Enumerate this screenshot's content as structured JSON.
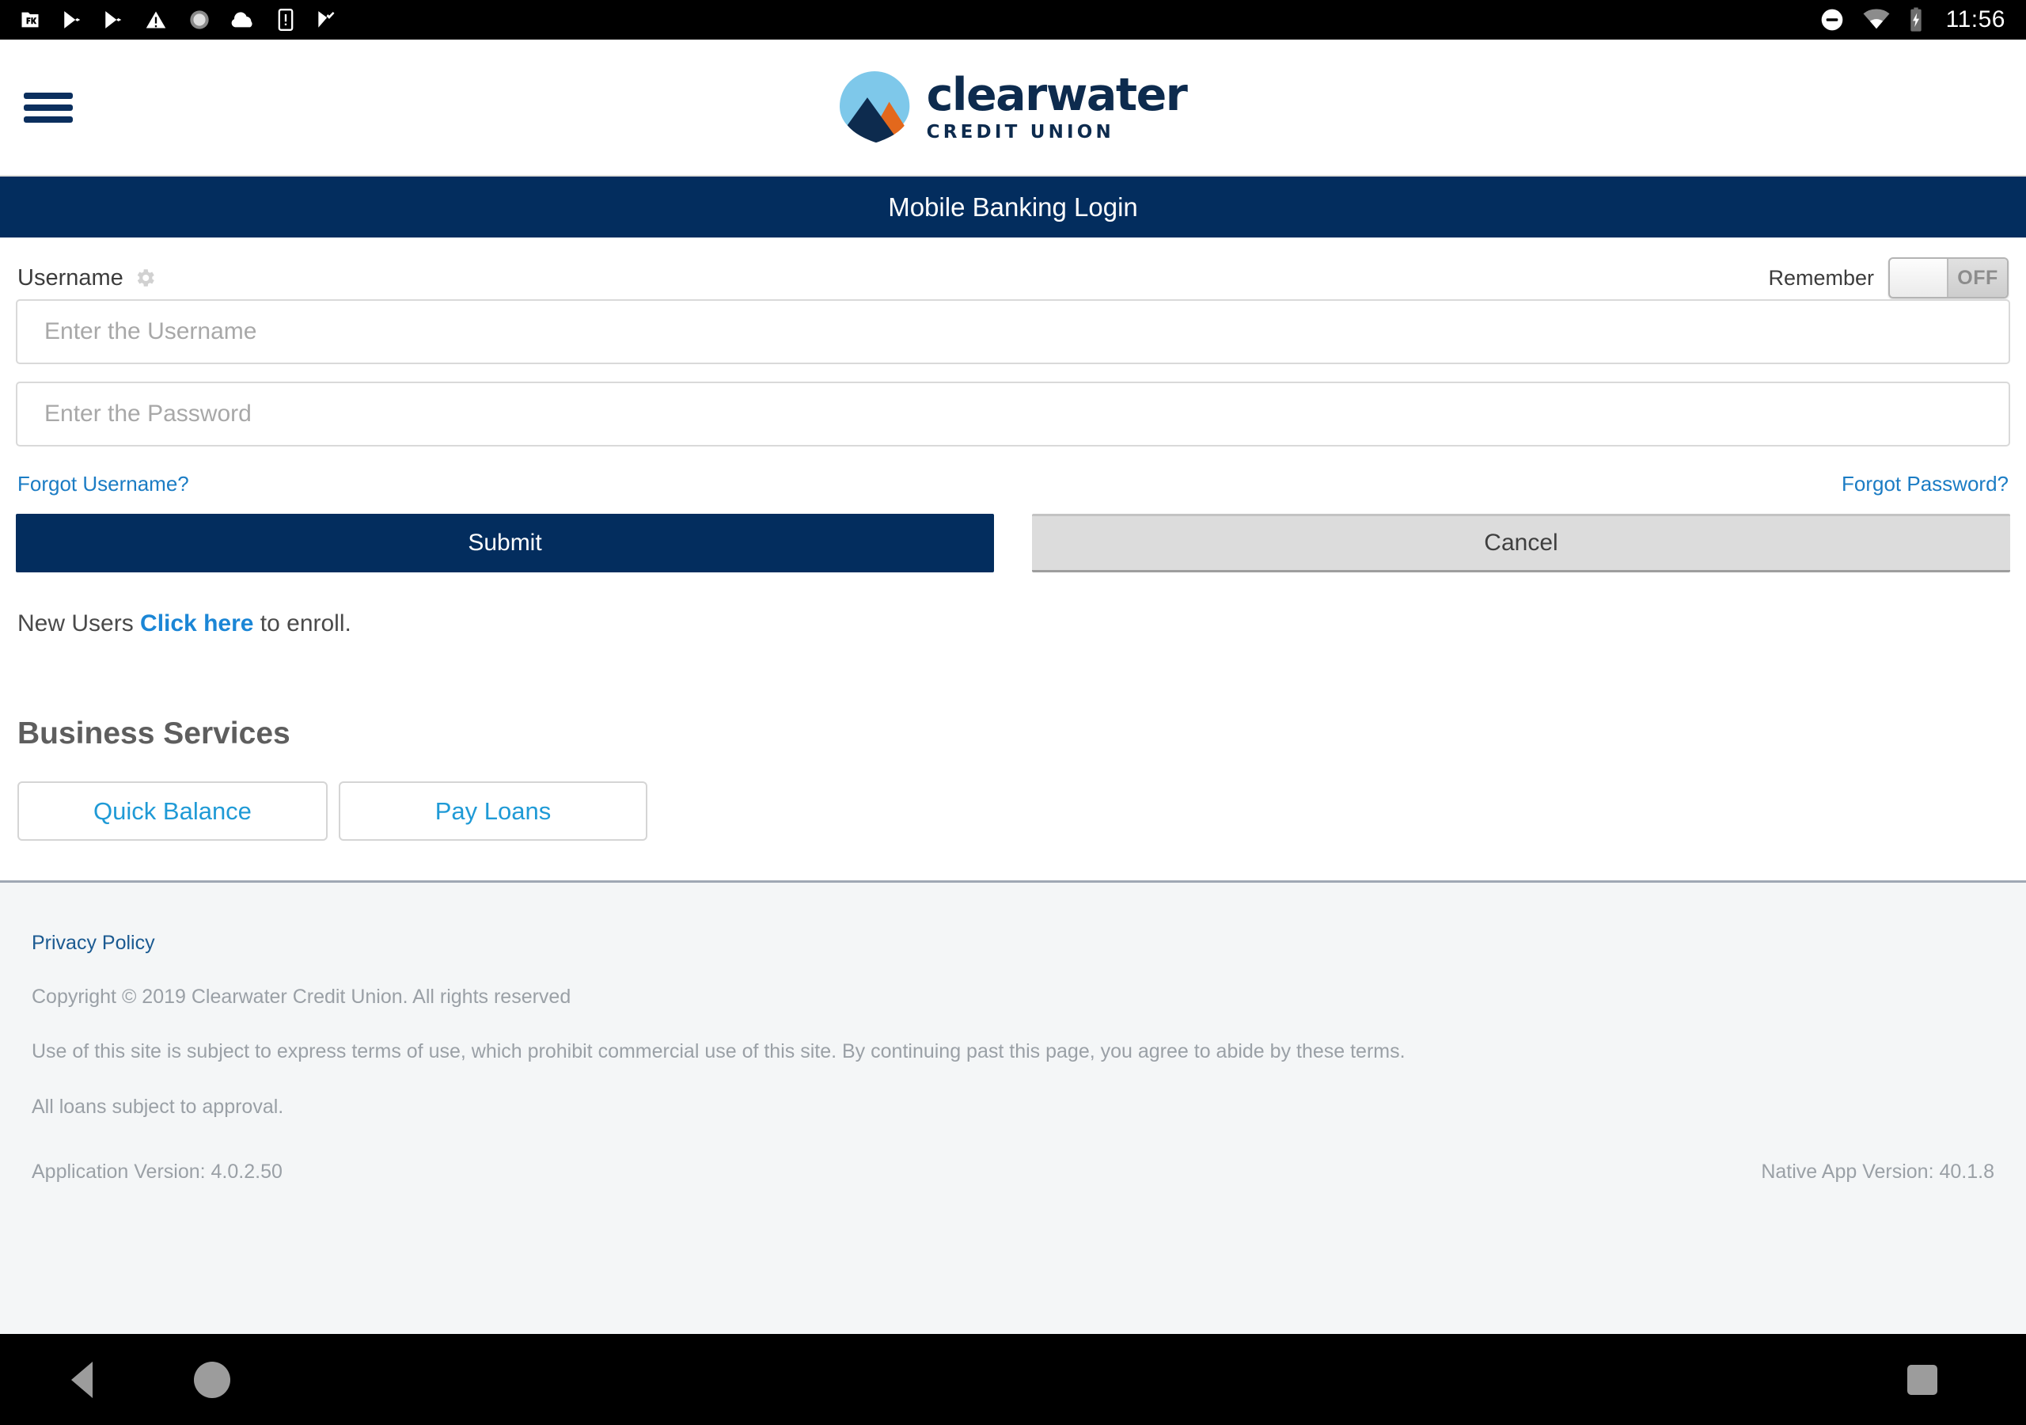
{
  "status_bar": {
    "icons": [
      "file-manager-icon",
      "play-store-icon",
      "play-store-icon",
      "warning-triangle-icon",
      "circle-dashed-icon",
      "cloud-icon",
      "phone-alert-icon",
      "check-flag-icon"
    ],
    "right_icons": [
      "do-not-disturb-icon",
      "wifi-icon",
      "battery-charging-icon"
    ],
    "time": "11:56"
  },
  "header": {
    "menu_label": "Menu",
    "logo_word": "clearwater",
    "logo_sub": "CREDIT UNION"
  },
  "title_bar": {
    "title": "Mobile Banking Login"
  },
  "login": {
    "username_label": "Username",
    "remember_label": "Remember",
    "remember_state": "OFF",
    "username_placeholder": "Enter the Username",
    "username_value": "",
    "password_placeholder": "Enter the Password",
    "password_value": "",
    "forgot_username": "Forgot Username?",
    "forgot_password": "Forgot Password?",
    "submit_label": "Submit",
    "cancel_label": "Cancel",
    "enroll_prefix": "New Users ",
    "enroll_link": "Click here",
    "enroll_suffix": " to enroll."
  },
  "business_services": {
    "title": "Business Services",
    "buttons": [
      {
        "label": "Quick Balance"
      },
      {
        "label": "Pay Loans"
      }
    ]
  },
  "footer": {
    "privacy_policy": "Privacy Policy",
    "copyright": "Copyright © 2019 Clearwater Credit Union. All rights reserved",
    "terms": "Use of this site is subject to express terms of use, which prohibit commercial use of this site. By continuing past this page, you agree to abide by these terms.",
    "loans": "All loans subject to approval.",
    "app_version": "Application Version: 4.0.2.50",
    "native_version": "Native App Version: 40.1.8"
  },
  "nav_bar": {
    "back": "back-button",
    "home": "home-button",
    "recents": "recents-button"
  },
  "colors": {
    "brand_navy": "#032d5e",
    "link_blue": "#1b7cc4",
    "accent_cyan": "#1f9ad6",
    "logo_light_blue": "#7ec8ea",
    "logo_orange": "#e3681c",
    "footer_bg": "#f4f6f7"
  }
}
